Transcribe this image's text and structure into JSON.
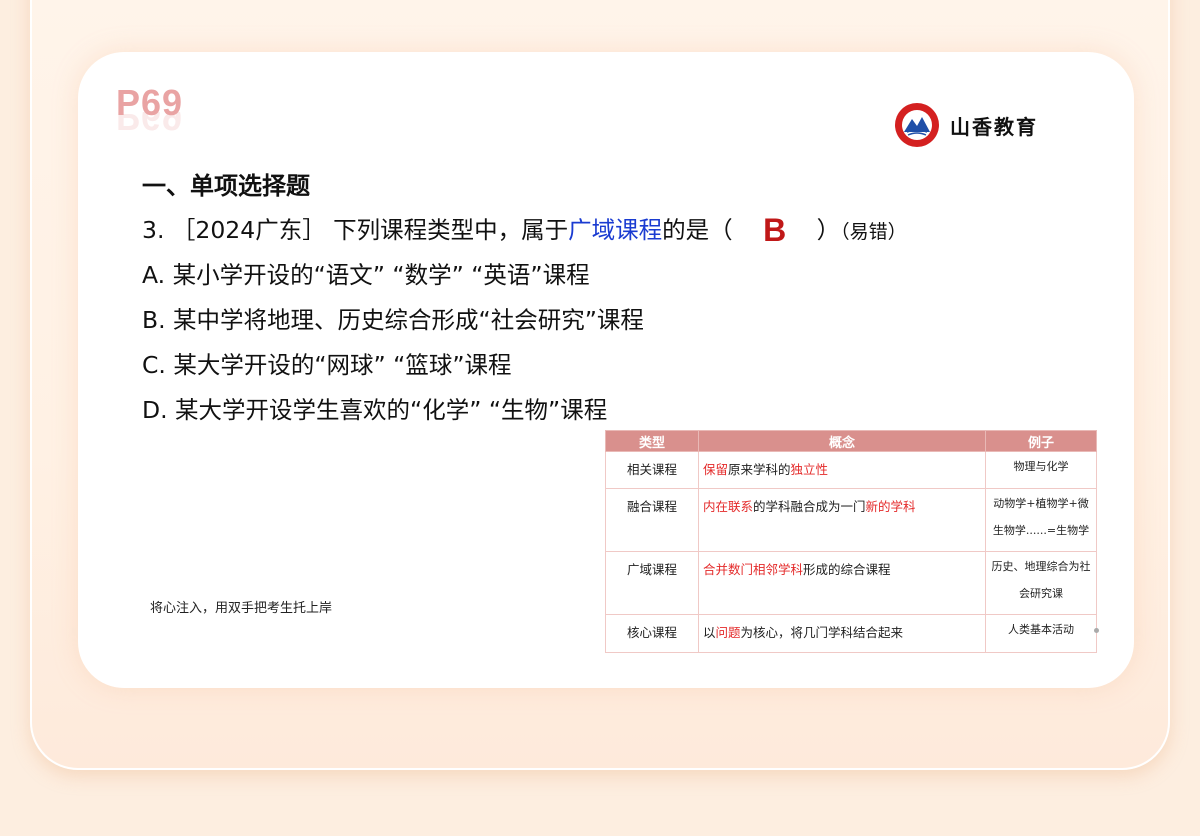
{
  "page": {
    "number": "P69"
  },
  "brand": {
    "name": "山香教育",
    "seal_text": "山香教育"
  },
  "section": {
    "title": "一、单项选择题"
  },
  "question": {
    "prefix": "3. ［2024广东］ 下列课程类型中，属于",
    "keyword": "广域课程",
    "suffix": "的是（",
    "answer": "B",
    "close": "）",
    "note": "（易错）"
  },
  "options": [
    "A. 某小学开设的“语文” “数学” “英语”课程",
    "B. 某中学将地理、历史综合形成“社会研究”课程",
    "C. 某大学开设的“网球” “篮球”课程",
    "D. 某大学开设学生喜欢的“化学” “生物”课程"
  ],
  "motto": "将心注入，用双手把考生托上岸",
  "table": {
    "headers": [
      "类型",
      "概念",
      "例子"
    ],
    "rows": [
      {
        "type": "相关课程",
        "c1": "保留",
        "c2": "原来学科的",
        "c3": "独立性",
        "c4": "",
        "c5": "",
        "example": "物理与化学"
      },
      {
        "type": "融合课程",
        "c1": "内在联系",
        "c2": "的学科融合成为一门",
        "c3": "新的学科",
        "c4": "",
        "c5": "",
        "example": "动物学+植物学+微生物学......=生物学"
      },
      {
        "type": "广域课程",
        "c1": "合并数门相邻学科",
        "c2": "形成的综合课程",
        "c3": "",
        "c4": "",
        "c5": "",
        "example": "历史、地理综合为社会研究课"
      },
      {
        "type": "核心课程",
        "c1": "",
        "c2": "以",
        "c3": "问题",
        "c4": "为核心，将几门学科结合起来",
        "c5": "",
        "example": "人类基本活动"
      }
    ]
  },
  "colors": {
    "accent_red": "#c01818",
    "keyword_blue": "#1a3bd1",
    "table_header": "#d9908d",
    "highlight_red": "#e42a2a"
  }
}
